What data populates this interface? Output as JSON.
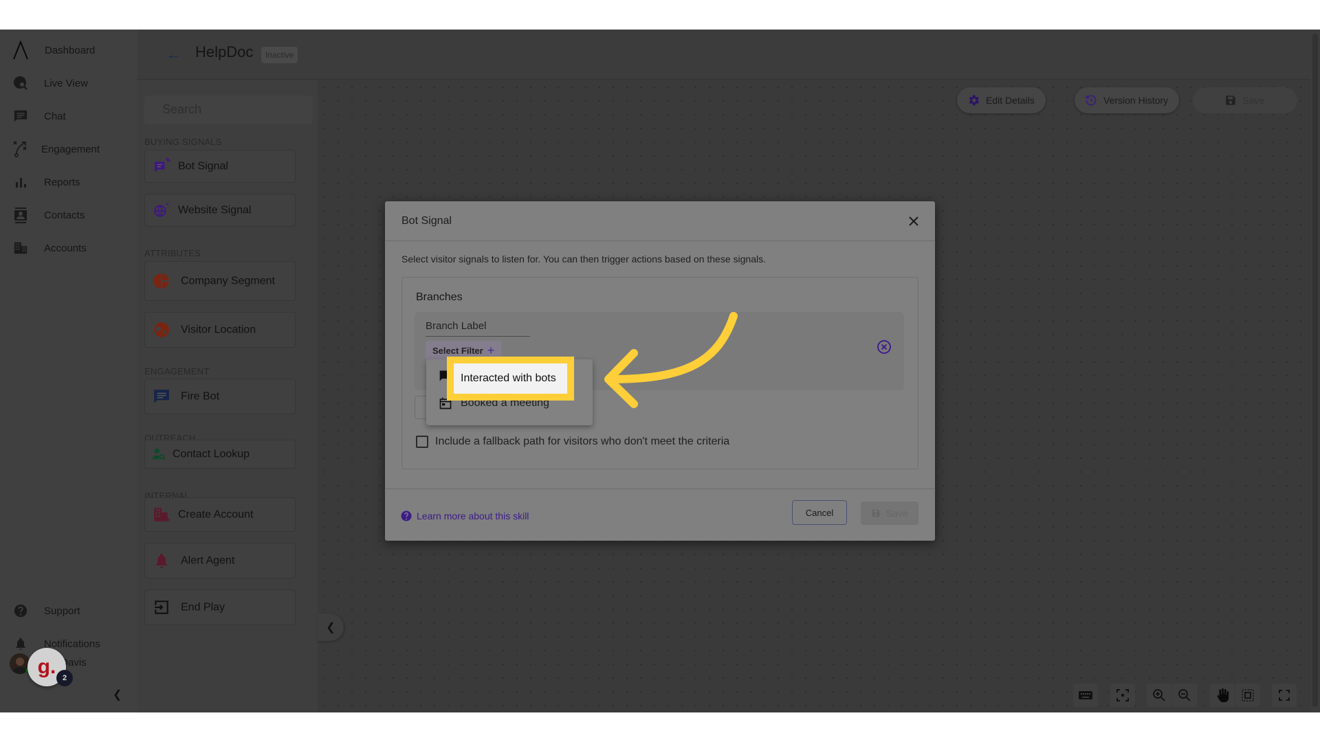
{
  "nav": {
    "items": [
      {
        "label": "Dashboard",
        "icon": "logo-icon"
      },
      {
        "label": "Live View",
        "icon": "live-view-icon"
      },
      {
        "label": "Chat",
        "icon": "chat-icon"
      },
      {
        "label": "Engagement",
        "icon": "engagement-icon"
      },
      {
        "label": "Reports",
        "icon": "reports-icon"
      },
      {
        "label": "Contacts",
        "icon": "contacts-icon"
      },
      {
        "label": "Accounts",
        "icon": "accounts-icon"
      }
    ],
    "bottom": [
      {
        "label": "Support",
        "icon": "help-icon"
      },
      {
        "label": "Notifications",
        "icon": "bell-icon"
      }
    ],
    "user_name": "Michael Davis",
    "user_name_visible": "ael Davis",
    "chat_widget_letter": "g.",
    "chat_widget_badge": "2"
  },
  "header": {
    "title": "HelpDoc",
    "status_badge": "Inactive"
  },
  "skills_panel": {
    "search_placeholder": "Search",
    "sections": [
      {
        "label": "BUYING SIGNALS",
        "items": [
          "Bot Signal",
          "Website Signal"
        ]
      },
      {
        "label": "ATTRIBUTES",
        "items": [
          "Company Segment",
          "Visitor Location"
        ]
      },
      {
        "label": "ENGAGEMENT",
        "items": [
          "Fire Bot"
        ]
      },
      {
        "label": "OUTREACH",
        "items": [
          "Contact Lookup"
        ]
      },
      {
        "label": "INTERNAL",
        "items": [
          "Create Account",
          "Alert Agent",
          "End Play"
        ]
      }
    ]
  },
  "toolbar": {
    "edit_details": "Edit Details",
    "version_history": "Version History",
    "save": "Save"
  },
  "modal": {
    "title": "Bot Signal",
    "description": "Select visitor signals to listen for. You can then trigger actions based on these signals.",
    "branches_title": "Branches",
    "branch_label": "Branch Label",
    "select_filter": "Select Filter",
    "fallback_label": "Include a fallback path for visitors who don't meet the criteria",
    "fallback_checked": false,
    "learn_more": "Learn more about this skill",
    "cancel": "Cancel",
    "save": "Save"
  },
  "filter_dropdown": {
    "options": [
      {
        "label": "Interacted with bots",
        "icon": "chat-icon",
        "highlighted": true
      },
      {
        "label": "Booked a meeting",
        "icon": "calendar-icon",
        "highlighted": false
      }
    ]
  },
  "colors": {
    "annotation_yellow": "#fecf39",
    "accent_purple": "#4b1fa0",
    "overlay": "#3a3a3a"
  }
}
